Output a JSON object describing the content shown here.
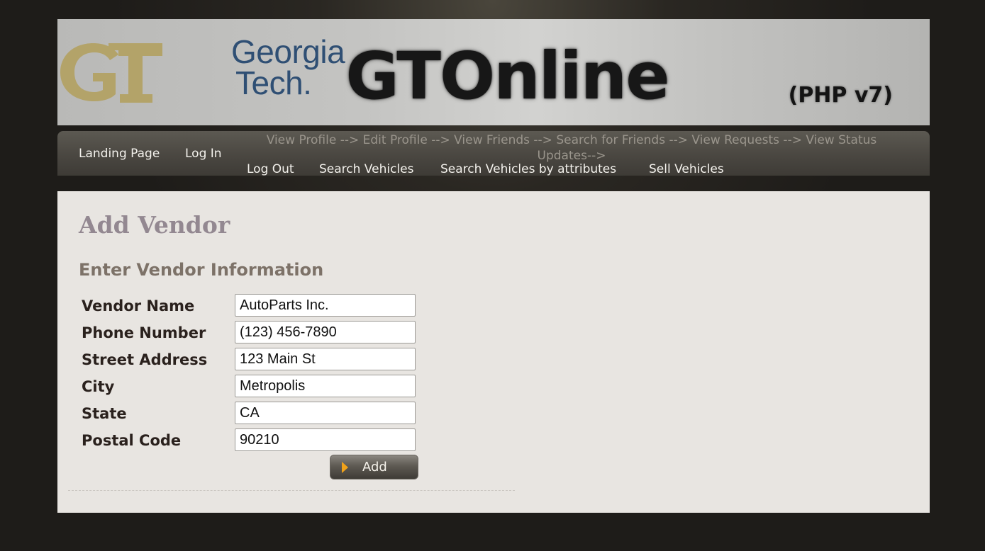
{
  "banner": {
    "logo_monogram": "GT",
    "logo_line1": "Georgia",
    "logo_line2": "Tech.",
    "title": "GTOnline",
    "version": "(PHP v7)"
  },
  "nav": {
    "landing_page": "Landing Page",
    "log_in": "Log In",
    "muted_line1": "View Profile --> Edit Profile --> View Friends --> Search for Friends --> View Requests --> View Status",
    "muted_line2": "Updates-->",
    "log_out": "Log Out",
    "search_vehicles": "Search Vehicles",
    "search_by_attributes": "Search Vehicles by attributes",
    "sell_vehicles": "Sell Vehicles"
  },
  "page": {
    "title": "Add Vendor",
    "section_title": "Enter Vendor Information"
  },
  "form": {
    "fields": [
      {
        "label": "Vendor Name",
        "value": "AutoParts Inc."
      },
      {
        "label": "Phone Number",
        "value": "(123) 456-7890"
      },
      {
        "label": "Street Address",
        "value": "123 Main St"
      },
      {
        "label": "City",
        "value": "Metropolis"
      },
      {
        "label": "State",
        "value": "CA"
      },
      {
        "label": "Postal Code",
        "value": "90210"
      }
    ],
    "submit_label": "Add"
  },
  "colors": {
    "page_background": "#1e1c19",
    "content_background": "#e8e5e1",
    "title_color": "#938891",
    "section_title_color": "#7d7268",
    "gt_gold": "#b3a369",
    "gt_navy": "#2f4f74",
    "button_arrow": "#f0a21a"
  },
  "icons": {
    "logo": "georgia-tech-logo",
    "submit_arrow": "play-arrow-icon"
  }
}
